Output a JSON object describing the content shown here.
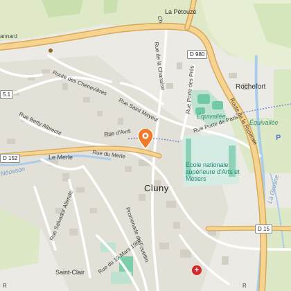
{
  "map": {
    "roads": {
      "la_petouze": "La Pétouze",
      "d980_shield": "D 980",
      "route_chenevieres": "Route des Chenevières",
      "rue_chanaise": "Rue de la Chanaise",
      "rue_porte_pres": "Rue Porte des Prés",
      "rue_saint_mayeul": "Rue Saint Mayeul",
      "rue_avril": "Rue d'Avril",
      "rue_porte_paris": "Rue Porte de Paris",
      "route_roseraie": "Route de la Roseraie",
      "rue_berty_albrecht": "Rue Berty Albrecht",
      "rue_du_merle": "Rue du Merle",
      "le_merle": "Le Merle",
      "d152_shield": "D 152",
      "d15_shield": "D 15",
      "d_left_shield": "5.1",
      "rue_salvador_allende": "Rue Salvador Allende",
      "promenade_fouettin": "Promenade du Fouettin",
      "rue_19_mars": "Rue du 19 Mars 1962",
      "rue_cut": "Ch",
      "rue_annard": "annard",
      "rue_bottom_right": "R",
      "rue_bottom_left": "R"
    },
    "places": {
      "cluny": "Cluny",
      "rochefort": "Rochefort",
      "saint_clair": "Saint-Clair",
      "equivallee_1": "Équivallée",
      "equivallee_2": "Équivallée",
      "school": "École nationale supérieure d'Arts et Métiers",
      "river_grosne": "La Grosne",
      "river_left": "Néosson",
      "p_label": "P"
    },
    "colors": {
      "background": "#eceae4",
      "field": "#dfe9c8",
      "forest": "#c9dfae",
      "primary_road": "#f6d48f",
      "primary_casing": "#d6a85c",
      "water": "#aacdec",
      "marker": "#f07a2a",
      "hospital": "#d22a2a",
      "sport": "#6fc9a6"
    },
    "icons": {
      "pin": "map-pin-icon",
      "hospital": "hospital-icon",
      "tree": "tree-icon"
    }
  }
}
